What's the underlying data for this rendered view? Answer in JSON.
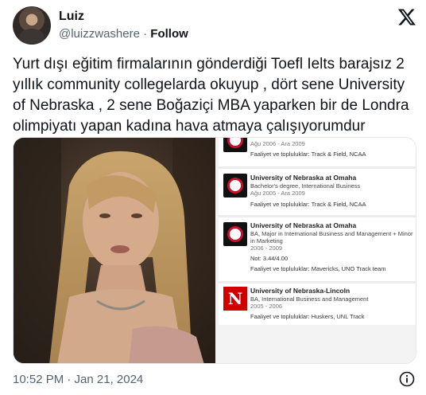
{
  "author": {
    "name": "Luiz",
    "handle": "@luizzwashere",
    "separator": "·",
    "follow_label": "Follow"
  },
  "tweet": {
    "text": "Yurt dışı eğitim firmalarının gönderdiği Toefl Ielts barajsız 2 yıllık community collegelarda okuyup , dört sene University of Nebraska , 2 sene Boğaziçi MBA yaparken bir de Londra olimpiyatı yapan kadına hava atmaya çalışıyorumdur",
    "timestamp": "10:52 PM · Jan 21, 2024"
  },
  "education": [
    {
      "school": "",
      "degree": "",
      "dates": "Ağu 2006 - Ara 2009",
      "note": "",
      "activities": "Faaliyet ve topluluklar: Track & Field, NCAA"
    },
    {
      "school": "University of Nebraska at Omaha",
      "degree": "Bachelor's degree, International Business",
      "dates": "Ağu 2005 - Ara 2009",
      "note": "",
      "activities": "Faaliyet ve topluluklar: Track & Field, NCAA"
    },
    {
      "school": "University of Nebraska at Omaha",
      "degree": "BA, Major in International Business and Management + Minor in Marketing",
      "dates": "2006 - 2009",
      "note": "Not: 3.44/4.00",
      "activities": "Faaliyet ve topluluklar: Mavericks, UNO Track team"
    },
    {
      "school": "University of Nebraska-Lincoln",
      "degree": "BA, International Business and Management",
      "dates": "2005 - 2006",
      "note": "",
      "activities": "Faaliyet ve topluluklar: Huskers, UNL Track"
    }
  ],
  "logos": {
    "lincoln_letter": "N"
  },
  "colors": {
    "text": "#0f1419",
    "muted": "#536471",
    "omaha_red": "#c8102e",
    "lincoln_red": "#d00000"
  }
}
